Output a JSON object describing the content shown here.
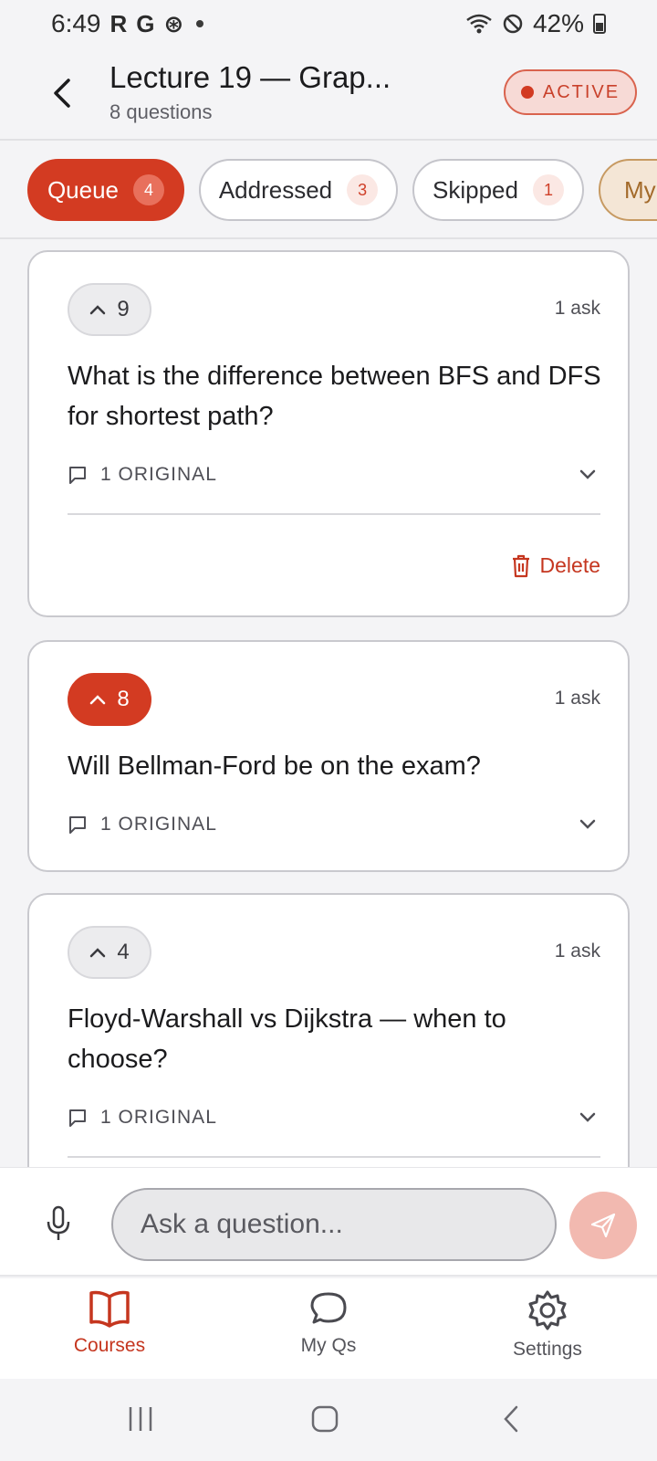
{
  "status_bar": {
    "time": "6:49",
    "notification_icons": [
      "R",
      "G",
      "⊛"
    ],
    "battery": "42%"
  },
  "header": {
    "title": "Lecture 19 — Grap...",
    "subtitle": "8 questions",
    "status_label": "ACTIVE"
  },
  "tabs": [
    {
      "label": "Queue",
      "count": "4"
    },
    {
      "label": "Addressed",
      "count": "3"
    },
    {
      "label": "Skipped",
      "count": "1"
    },
    {
      "label": "My"
    }
  ],
  "questions": [
    {
      "votes": "9",
      "asks": "1 ask",
      "text": "What is the difference between BFS and DFS for shortest path?",
      "originals": "1 ORIGINAL",
      "delete_label": "Delete"
    },
    {
      "votes": "8",
      "asks": "1 ask",
      "text": "Will Bellman-Ford be on the exam?",
      "originals": "1 ORIGINAL"
    },
    {
      "votes": "4",
      "asks": "1 ask",
      "text": "Floyd-Warshall vs Dijkstra — when to choose?",
      "originals": "1 ORIGINAL"
    }
  ],
  "ask_bar": {
    "placeholder": "Ask a question..."
  },
  "nav": [
    {
      "label": "Courses",
      "icon": "book-icon"
    },
    {
      "label": "My Qs",
      "icon": "chat-bubble-icon"
    },
    {
      "label": "Settings",
      "icon": "gear-icon"
    }
  ],
  "colors": {
    "accent": "#d33b22",
    "accent_light": "#f7dad6",
    "send_disabled": "#f2b9b0",
    "my_tab_bg": "#f4e6d6"
  }
}
